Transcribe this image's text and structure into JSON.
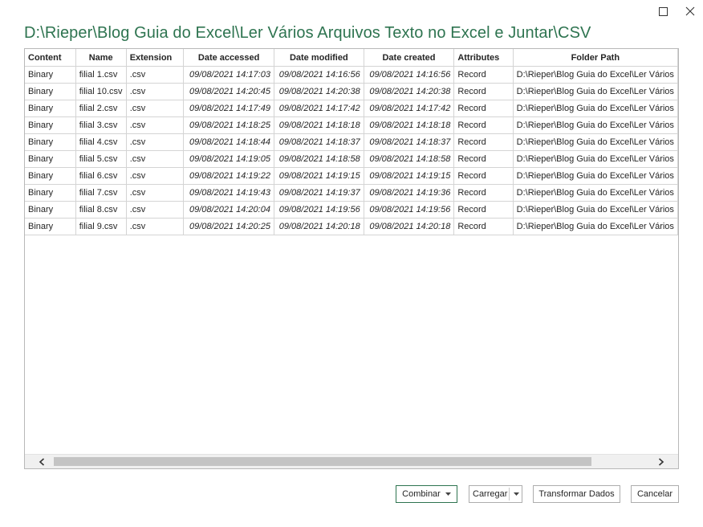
{
  "window": {
    "title": "D:\\Rieper\\Blog Guia do Excel\\Ler Vários Arquivos Texto no Excel e Juntar\\CSV"
  },
  "table": {
    "columns": [
      "Content",
      "Name",
      "Extension",
      "Date accessed",
      "Date modified",
      "Date created",
      "Attributes",
      "Folder Path"
    ],
    "rows": [
      [
        "Binary",
        "filial 1.csv",
        ".csv",
        "09/08/2021 14:17:03",
        "09/08/2021 14:16:56",
        "09/08/2021 14:16:56",
        "Record",
        "D:\\Rieper\\Blog Guia do Excel\\Ler Vários"
      ],
      [
        "Binary",
        "filial 10.csv",
        ".csv",
        "09/08/2021 14:20:45",
        "09/08/2021 14:20:38",
        "09/08/2021 14:20:38",
        "Record",
        "D:\\Rieper\\Blog Guia do Excel\\Ler Vários"
      ],
      [
        "Binary",
        "filial 2.csv",
        ".csv",
        "09/08/2021 14:17:49",
        "09/08/2021 14:17:42",
        "09/08/2021 14:17:42",
        "Record",
        "D:\\Rieper\\Blog Guia do Excel\\Ler Vários"
      ],
      [
        "Binary",
        "filial 3.csv",
        ".csv",
        "09/08/2021 14:18:25",
        "09/08/2021 14:18:18",
        "09/08/2021 14:18:18",
        "Record",
        "D:\\Rieper\\Blog Guia do Excel\\Ler Vários"
      ],
      [
        "Binary",
        "filial 4.csv",
        ".csv",
        "09/08/2021 14:18:44",
        "09/08/2021 14:18:37",
        "09/08/2021 14:18:37",
        "Record",
        "D:\\Rieper\\Blog Guia do Excel\\Ler Vários"
      ],
      [
        "Binary",
        "filial 5.csv",
        ".csv",
        "09/08/2021 14:19:05",
        "09/08/2021 14:18:58",
        "09/08/2021 14:18:58",
        "Record",
        "D:\\Rieper\\Blog Guia do Excel\\Ler Vários"
      ],
      [
        "Binary",
        "filial 6.csv",
        ".csv",
        "09/08/2021 14:19:22",
        "09/08/2021 14:19:15",
        "09/08/2021 14:19:15",
        "Record",
        "D:\\Rieper\\Blog Guia do Excel\\Ler Vários"
      ],
      [
        "Binary",
        "filial 7.csv",
        ".csv",
        "09/08/2021 14:19:43",
        "09/08/2021 14:19:37",
        "09/08/2021 14:19:36",
        "Record",
        "D:\\Rieper\\Blog Guia do Excel\\Ler Vários"
      ],
      [
        "Binary",
        "filial 8.csv",
        ".csv",
        "09/08/2021 14:20:04",
        "09/08/2021 14:19:56",
        "09/08/2021 14:19:56",
        "Record",
        "D:\\Rieper\\Blog Guia do Excel\\Ler Vários"
      ],
      [
        "Binary",
        "filial 9.csv",
        ".csv",
        "09/08/2021 14:20:25",
        "09/08/2021 14:20:18",
        "09/08/2021 14:20:18",
        "Record",
        "D:\\Rieper\\Blog Guia do Excel\\Ler Vários"
      ]
    ]
  },
  "buttons": {
    "combinar": "Combinar",
    "carregar": "Carregar",
    "transformar": "Transformar Dados",
    "cancelar": "Cancelar"
  },
  "icons": {
    "maximize": "maximize-icon",
    "close": "close-icon",
    "scroll_left": "chevron-left-icon",
    "scroll_right": "chevron-right-icon",
    "dropdown": "caret-down-icon"
  },
  "colors": {
    "title": "#2e7450",
    "primary_border": "#2e7450"
  }
}
